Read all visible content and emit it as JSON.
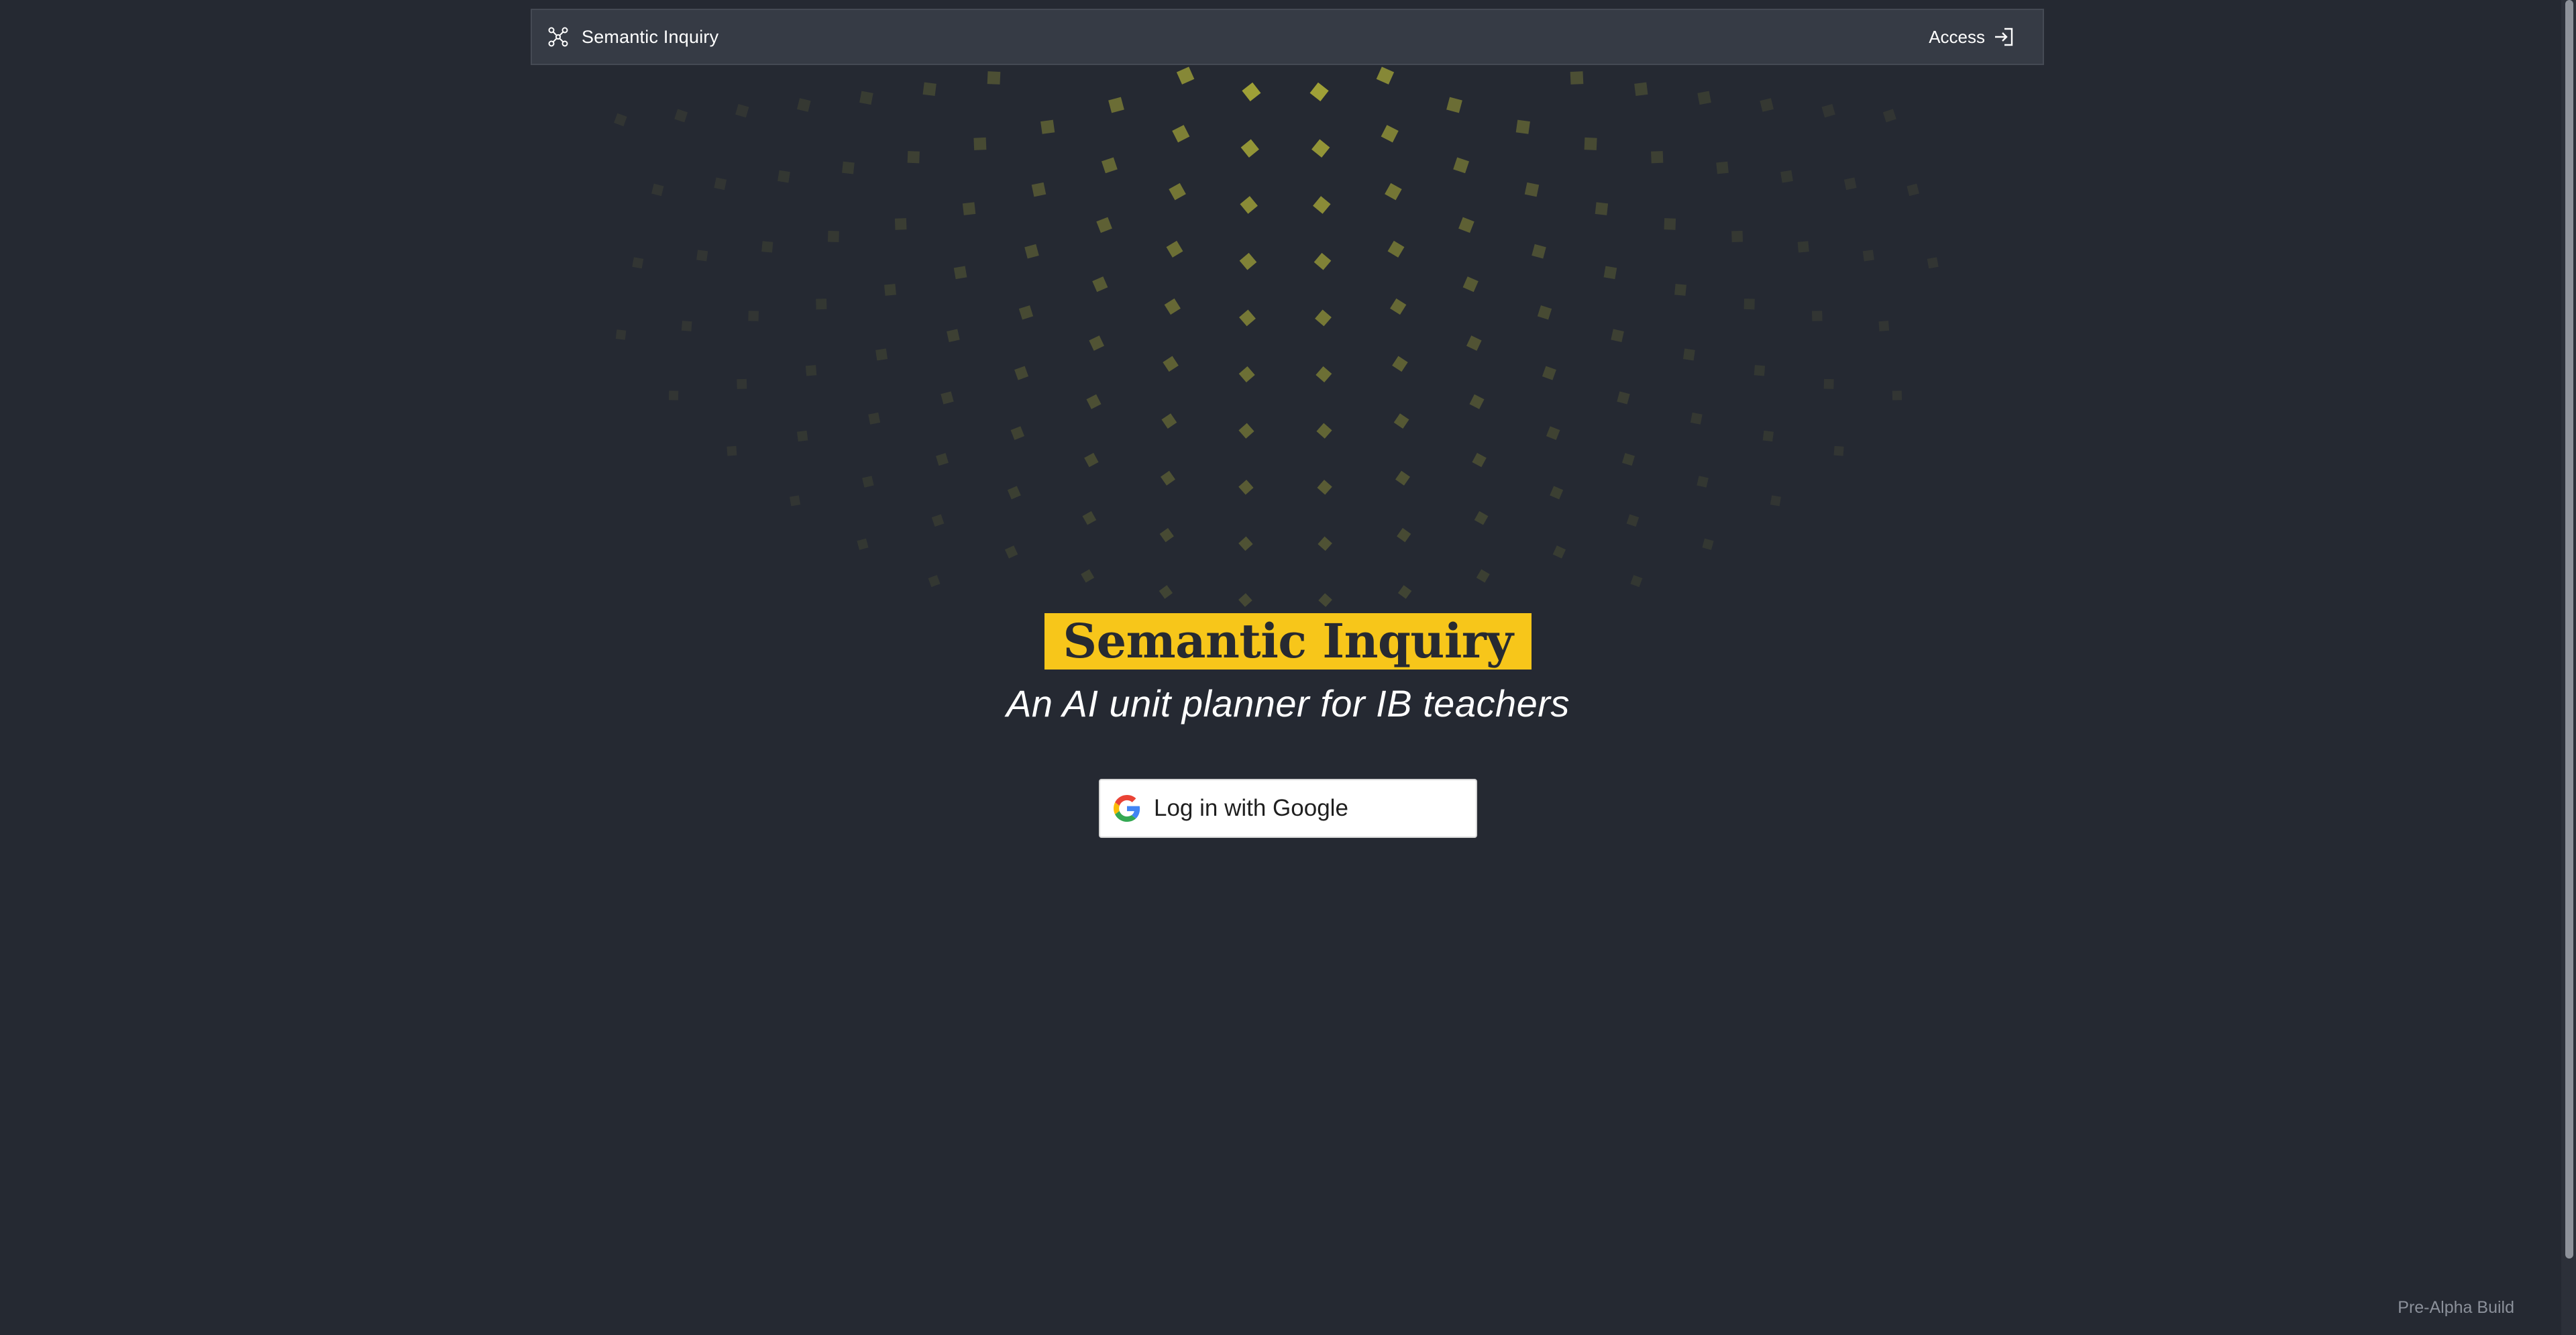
{
  "navbar": {
    "brand_label": "Semantic Inquiry",
    "brand_icon": "network-nodes-icon",
    "access_label": "Access",
    "access_icon": "sign-in-icon"
  },
  "hero": {
    "title": "Semantic Inquiry",
    "subtitle": "An AI unit planner for IB teachers",
    "google_button_label": "Log in with Google",
    "google_icon": "google-g-icon"
  },
  "footer": {
    "build_label": "Pre-Alpha Build"
  },
  "colors": {
    "background": "#252932",
    "navbar": "#363b45",
    "accent_yellow": "#f7c61a",
    "dot_color": "#c8c83a"
  }
}
